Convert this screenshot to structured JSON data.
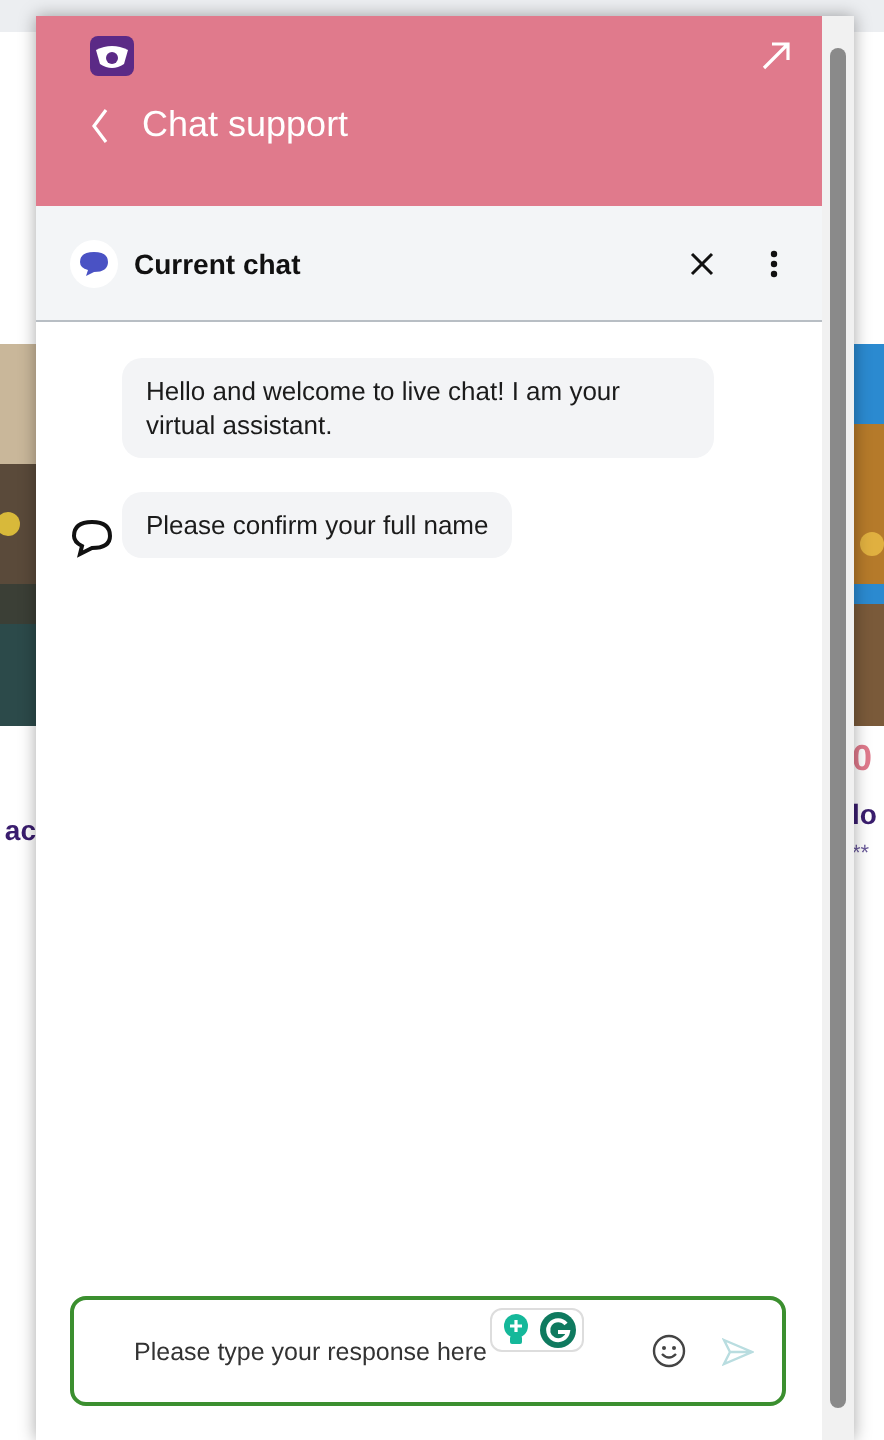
{
  "background_page": {
    "left_card": {
      "title": "ac"
    },
    "right_card": {
      "price": "0",
      "title": "lo",
      "rating": "**"
    }
  },
  "chat_widget": {
    "title": "Chat support",
    "conversation": {
      "title": "Current chat"
    },
    "messages": [
      {
        "text": "Hello and welcome to live chat! I am your virtual assistant.",
        "show_avatar": false
      },
      {
        "text": "Please confirm your full name",
        "show_avatar": true
      }
    ],
    "composer": {
      "placeholder": "Please type your response here",
      "focused": true
    }
  }
}
